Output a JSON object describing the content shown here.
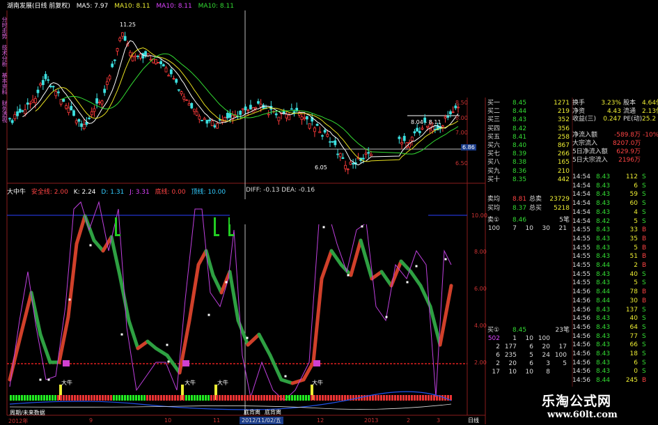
{
  "title": {
    "stock": "湖南发展(日线 前复权)",
    "ma5": "MA5: 7.97",
    "ma10a": "MA10: 8.11",
    "ma10b": "MA10: 8.11",
    "ma10c": "MA10: 8.11"
  },
  "side_tabs": [
    "分时走势",
    "技术分析",
    "基本资料",
    "财务透视"
  ],
  "price_chart": {
    "high_label": "11.25",
    "low_label": "6.05",
    "crosshair_price": "6.86",
    "right_label": "8.04 - 8.11",
    "y_ticks": [
      "8.50",
      "8.00",
      "7.00",
      "6.50"
    ]
  },
  "indicator": {
    "name": "大中牛",
    "safe_line": "安全线: 2.00",
    "k": "K: 2.24",
    "d": "D: 1.31",
    "j": "J: 3.31",
    "bottom": "底线: 0.00",
    "top": "顶线: 10.00",
    "macd_diff": "DIFF: -0.13",
    "macd_dea": "DEA: -0.16",
    "y_ticks": [
      "10.00",
      "8.00",
      "6.00",
      "4.00",
      "2.00"
    ],
    "signal_labels": [
      "大牛",
      "大牛",
      "大牛",
      "大牛"
    ],
    "bottom_labels": [
      "底背离",
      "底背离"
    ],
    "legend": "周期/未来数据"
  },
  "date_axis": {
    "labels": [
      "2012年",
      "9",
      "10",
      "11",
      "12",
      "2013",
      "2",
      "3"
    ],
    "crosshair_date": "2012/11/02/五",
    "period": "日线"
  },
  "order_book": {
    "buy": [
      {
        "label": "买一",
        "price": "8.45",
        "vol": "1271"
      },
      {
        "label": "买二",
        "price": "8.44",
        "vol": "219"
      },
      {
        "label": "买三",
        "price": "8.43",
        "vol": "352"
      },
      {
        "label": "买四",
        "price": "8.42",
        "vol": "356"
      },
      {
        "label": "买五",
        "price": "8.41",
        "vol": "258"
      },
      {
        "label": "买六",
        "price": "8.40",
        "vol": "867"
      },
      {
        "label": "买七",
        "price": "8.39",
        "vol": "266"
      },
      {
        "label": "买八",
        "price": "8.38",
        "vol": "165"
      },
      {
        "label": "买九",
        "price": "8.36",
        "vol": "210"
      },
      {
        "label": "买十",
        "price": "8.35",
        "vol": "442"
      }
    ],
    "sell_avg": {
      "label": "卖均",
      "price": "8.81",
      "total_label": "总卖",
      "total": "23729"
    },
    "buy_avg": {
      "label": "买均",
      "price": "8.37",
      "total_label": "总买",
      "total": "5218"
    },
    "sell1": {
      "label": "卖①",
      "price": "8.46",
      "count": "5笔"
    },
    "sell1_queue": [
      "100",
      "7",
      "10",
      "30",
      "21"
    ],
    "buy1": {
      "label": "买①",
      "price": "8.45",
      "count": "23笔"
    },
    "buy1_queue": [
      [
        "502",
        "1",
        "10",
        "100"
      ],
      [
        "2",
        "177",
        "6",
        "20",
        "17"
      ],
      [
        "6",
        "235",
        "5",
        "24",
        "100"
      ],
      [
        "2",
        "20",
        "6",
        "3",
        "5"
      ],
      [
        "17",
        "10",
        "10",
        "8",
        ""
      ]
    ]
  },
  "stats": [
    {
      "k1": "换手",
      "v1": "3.23%",
      "k2": "股本",
      "v2": "4.64亿"
    },
    {
      "k1": "净资",
      "v1": "4.43",
      "k2": "流通",
      "v2": "2.13亿"
    },
    {
      "k1": "收益(三)",
      "v1": "0.247",
      "k2": "PE(动)",
      "v2": "25.2"
    }
  ],
  "flows": [
    {
      "label": "净流入额",
      "value": "-589.8万",
      "extra": "-10%"
    },
    {
      "label": "大宗流入",
      "value": "8207.0万",
      "extra": ""
    },
    {
      "label": "5日净流入额",
      "value": "629.9万",
      "extra": ""
    },
    {
      "label": "5日大宗流入",
      "value": "2196万",
      "extra": ""
    }
  ],
  "ticks": [
    {
      "t": "14:54",
      "p": "8.43",
      "v": "112",
      "d": "S"
    },
    {
      "t": "14:54",
      "p": "8.43",
      "v": "6",
      "d": "S"
    },
    {
      "t": "14:54",
      "p": "8.43",
      "v": "59",
      "d": "S"
    },
    {
      "t": "14:54",
      "p": "8.43",
      "v": "60",
      "d": "S"
    },
    {
      "t": "14:54",
      "p": "8.43",
      "v": "4",
      "d": "S"
    },
    {
      "t": "14:54",
      "p": "8.42",
      "v": "5",
      "d": "S"
    },
    {
      "t": "14:55",
      "p": "8.43",
      "v": "33",
      "d": "B"
    },
    {
      "t": "14:55",
      "p": "8.43",
      "v": "35",
      "d": "B"
    },
    {
      "t": "14:55",
      "p": "8.43",
      "v": "5",
      "d": "B"
    },
    {
      "t": "14:55",
      "p": "8.43",
      "v": "51",
      "d": "B"
    },
    {
      "t": "14:55",
      "p": "8.44",
      "v": "2",
      "d": "B"
    },
    {
      "t": "14:55",
      "p": "8.43",
      "v": "40",
      "d": "S"
    },
    {
      "t": "14:55",
      "p": "8.43",
      "v": "5",
      "d": "S"
    },
    {
      "t": "14:56",
      "p": "8.44",
      "v": "78",
      "d": "B"
    },
    {
      "t": "14:56",
      "p": "8.44",
      "v": "30",
      "d": "B"
    },
    {
      "t": "14:56",
      "p": "8.43",
      "v": "137",
      "d": "S"
    },
    {
      "t": "14:56",
      "p": "8.43",
      "v": "40",
      "d": "S"
    },
    {
      "t": "14:56",
      "p": "8.43",
      "v": "64",
      "d": "S"
    },
    {
      "t": "14:56",
      "p": "8.43",
      "v": "77",
      "d": "S"
    },
    {
      "t": "14:56",
      "p": "8.43",
      "v": "66",
      "d": "S"
    },
    {
      "t": "14:56",
      "p": "8.43",
      "v": "18",
      "d": "S"
    },
    {
      "t": "14:56",
      "p": "8.43",
      "v": "6",
      "d": "S"
    },
    {
      "t": "14:56",
      "p": "8.43",
      "v": "0",
      "d": "S"
    },
    {
      "t": "14:56",
      "p": "8.44",
      "v": "245",
      "d": "B"
    }
  ],
  "watermark": {
    "line1": "乐淘公式网",
    "line2": "www.60lt.com"
  },
  "colors": {
    "up": "#ff3b3b",
    "down": "#3ce0e0",
    "ma5": "#ffffff",
    "ma10": "#e8e020"
  }
}
